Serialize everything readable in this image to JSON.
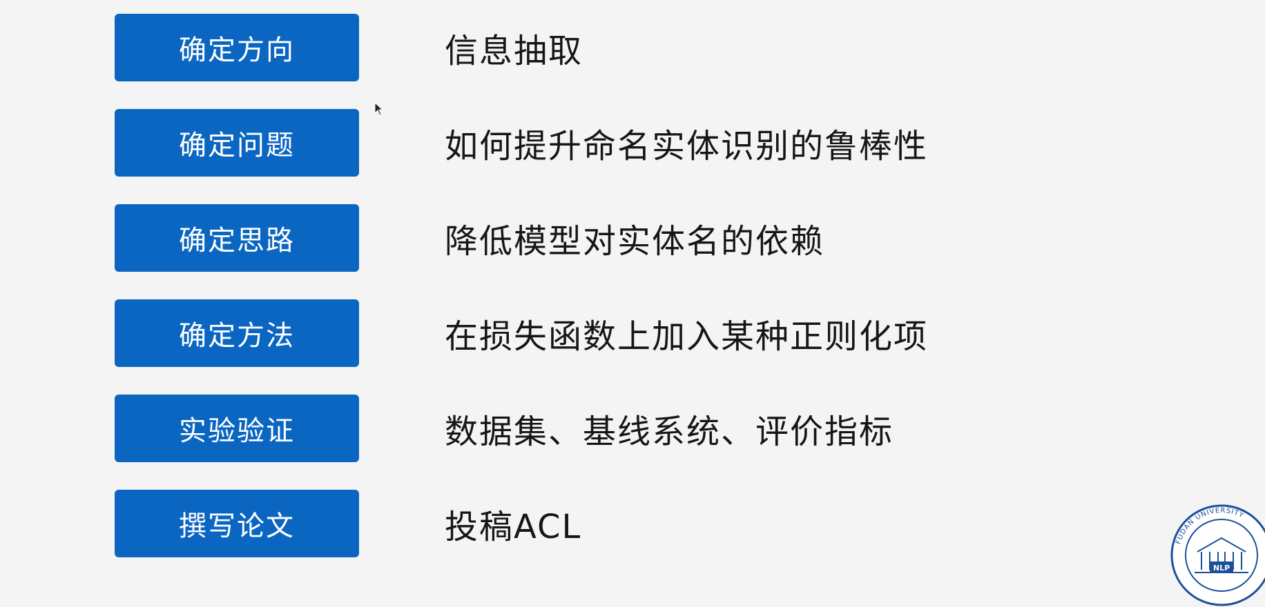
{
  "steps": [
    {
      "label": "确定方向",
      "desc": "信息抽取"
    },
    {
      "label": "确定问题",
      "desc": "如何提升命名实体识别的鲁棒性"
    },
    {
      "label": "确定思路",
      "desc": "降低模型对实体名的依赖"
    },
    {
      "label": "确定方法",
      "desc": "在损失函数上加入某种正则化项"
    },
    {
      "label": "实验验证",
      "desc": "数据集、基线系统、评价指标"
    },
    {
      "label": "撰写论文",
      "desc": "投稿ACL"
    }
  ],
  "logo": {
    "ring_text": "FUDAN UNIVERSITY",
    "center_text": "NLP",
    "icon": "fudan-nlp-logo-icon"
  },
  "colors": {
    "accent": "#0b66c2",
    "background": "#f4f4f4",
    "text": "#161616"
  }
}
